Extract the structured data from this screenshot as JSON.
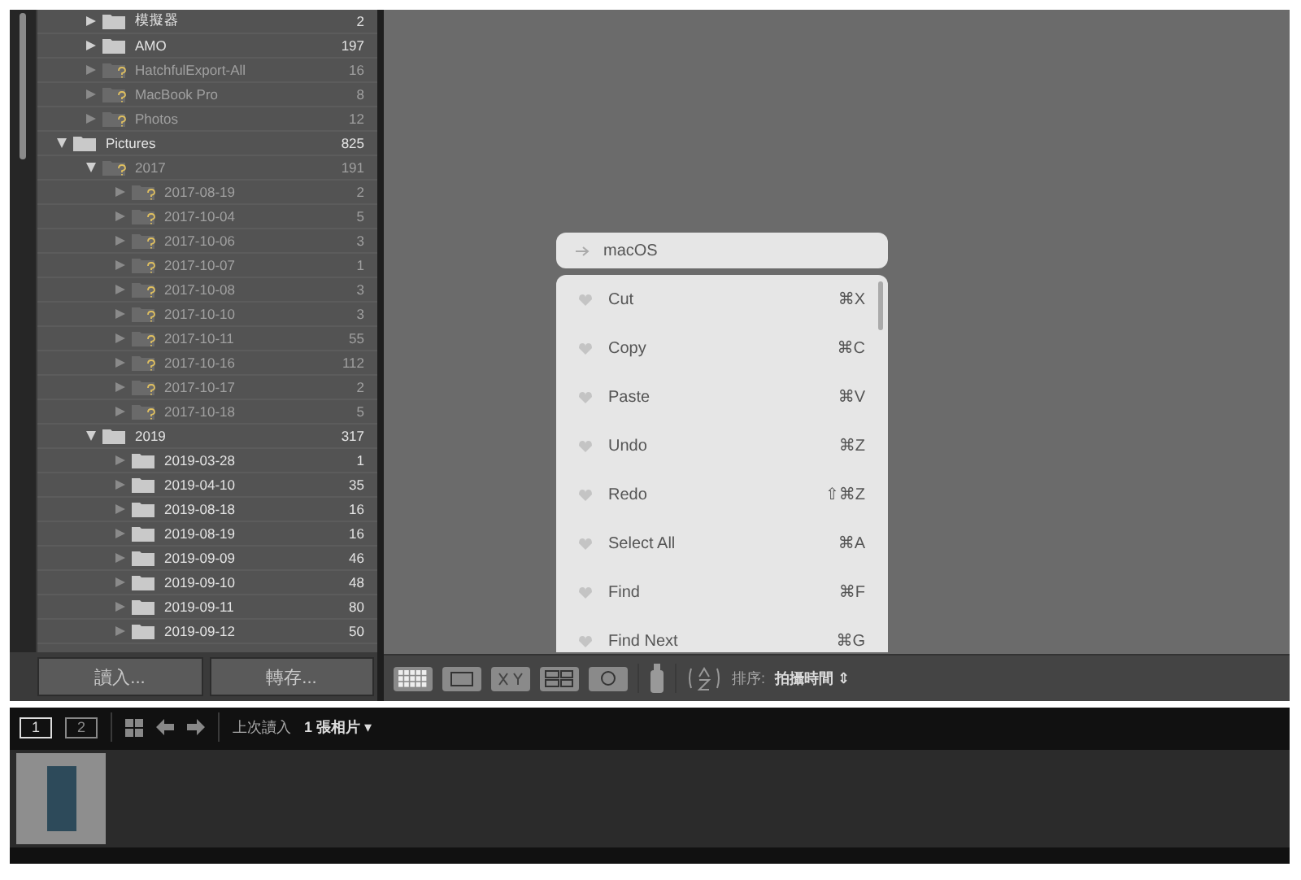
{
  "folder_tree": {
    "orphan_rows": [
      {
        "name": "模擬器",
        "count": "2",
        "kind": "normal",
        "expanded": false
      },
      {
        "name": "AMO",
        "count": "197",
        "kind": "normal",
        "expanded": false
      },
      {
        "name": "HatchfulExport-All",
        "count": "16",
        "kind": "missing"
      },
      {
        "name": "MacBook Pro",
        "count": "8",
        "kind": "missing"
      },
      {
        "name": "Photos",
        "count": "12",
        "kind": "missing"
      }
    ],
    "folders": [
      {
        "name": "Pictures",
        "count": "825",
        "kind": "normal",
        "expanded": true,
        "children": [
          {
            "name": "2017",
            "count": "191",
            "kind": "missing",
            "expanded": true,
            "children": [
              {
                "name": "2017-08-19",
                "count": "2",
                "kind": "missing"
              },
              {
                "name": "2017-10-04",
                "count": "5",
                "kind": "missing"
              },
              {
                "name": "2017-10-06",
                "count": "3",
                "kind": "missing"
              },
              {
                "name": "2017-10-07",
                "count": "1",
                "kind": "missing"
              },
              {
                "name": "2017-10-08",
                "count": "3",
                "kind": "missing"
              },
              {
                "name": "2017-10-10",
                "count": "3",
                "kind": "missing"
              },
              {
                "name": "2017-10-11",
                "count": "55",
                "kind": "missing"
              },
              {
                "name": "2017-10-16",
                "count": "112",
                "kind": "missing"
              },
              {
                "name": "2017-10-17",
                "count": "2",
                "kind": "missing"
              },
              {
                "name": "2017-10-18",
                "count": "5",
                "kind": "missing"
              }
            ]
          },
          {
            "name": "2019",
            "count": "317",
            "kind": "normal",
            "expanded": true,
            "children": [
              {
                "name": "2019-03-28",
                "count": "1",
                "kind": "normal"
              },
              {
                "name": "2019-04-10",
                "count": "35",
                "kind": "normal"
              },
              {
                "name": "2019-08-18",
                "count": "16",
                "kind": "normal"
              },
              {
                "name": "2019-08-19",
                "count": "16",
                "kind": "normal"
              },
              {
                "name": "2019-09-09",
                "count": "46",
                "kind": "normal"
              },
              {
                "name": "2019-09-10",
                "count": "48",
                "kind": "normal"
              },
              {
                "name": "2019-09-11",
                "count": "80",
                "kind": "normal"
              },
              {
                "name": "2019-09-12",
                "count": "50",
                "kind": "normal"
              }
            ]
          }
        ]
      }
    ]
  },
  "sidebar_buttons": [
    "讀入...",
    "轉存..."
  ],
  "popup": {
    "header": "macOS",
    "items": [
      {
        "label": "Cut",
        "shortcut": "⌘X"
      },
      {
        "label": "Copy",
        "shortcut": "⌘C"
      },
      {
        "label": "Paste",
        "shortcut": "⌘V"
      },
      {
        "label": "Undo",
        "shortcut": "⌘Z"
      },
      {
        "label": "Redo",
        "shortcut": "⇧⌘Z"
      },
      {
        "label": "Select All",
        "shortcut": "⌘A"
      },
      {
        "label": "Find",
        "shortcut": "⌘F"
      },
      {
        "label": "Find Next",
        "shortcut": "⌘G"
      }
    ]
  },
  "toolbar": {
    "sort_label": "排序:",
    "sort_value": "拍攝時間",
    "sort_arrows": "⇕"
  },
  "filmstrip_bar": {
    "screens": [
      {
        "label": "1",
        "selected": true
      },
      {
        "label": "2",
        "selected": false
      }
    ],
    "source": "上次讀入",
    "photo_count": "1 張相片",
    "count_caret": "▾"
  }
}
